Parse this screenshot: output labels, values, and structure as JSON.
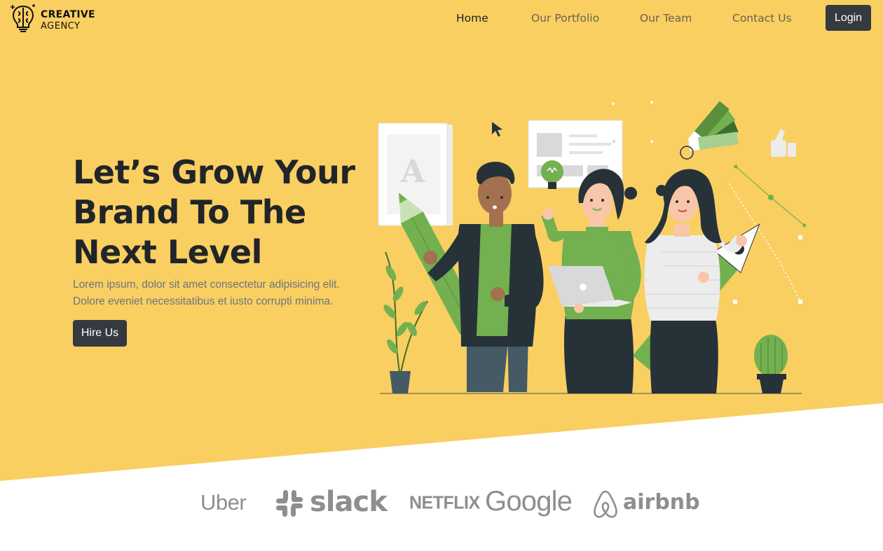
{
  "colors": {
    "hero_bg": "#f9cf62",
    "accent_green": "#73b04f",
    "dark": "#343a40",
    "brand_gray": "#8e8e8e"
  },
  "logo": {
    "line1": "CREATIVE",
    "line2": "AGENCY",
    "icon": "brain-lightbulb-icon"
  },
  "nav": {
    "links": [
      "Home",
      "Our Portfolio",
      "Our Team",
      "Contact Us"
    ],
    "active": "Home",
    "login_label": "Login"
  },
  "hero": {
    "headline": "Let’s Grow Your Brand To The Next Level",
    "lead": "Lorem ipsum, dolor sit amet consectetur adipisicing elit. Dolore eveniet necessitatibus et iusto corrupti minima.",
    "cta_label": "Hire Us",
    "illustration_letter": "A"
  },
  "brands": {
    "uber": "Uber",
    "slack": "slack",
    "netflix": "NETFLIX",
    "google": "Google",
    "airbnb": "airbnb"
  }
}
